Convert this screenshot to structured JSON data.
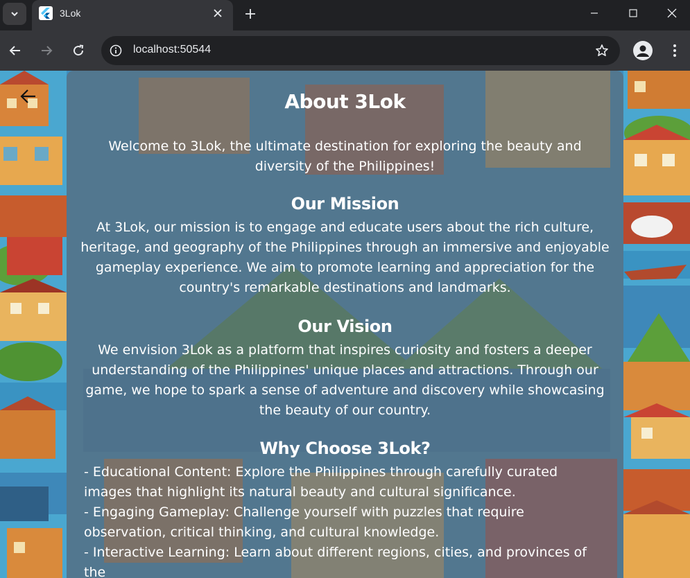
{
  "browser": {
    "tab_title": "3Lok",
    "url": "localhost:50544"
  },
  "page": {
    "title": "About 3Lok",
    "intro": "Welcome to 3Lok, the ultimate destination for exploring the beauty and diversity of the Philippines!",
    "mission": {
      "heading": "Our Mission",
      "text": "At 3Lok, our mission is to engage and educate users about the rich culture, heritage, and geography of the Philippines through an immersive and enjoyable gameplay experience. We aim to promote learning and appreciation for the country's remarkable destinations and landmarks."
    },
    "vision": {
      "heading": "Our Vision",
      "text": "We envision 3Lok as a platform that inspires curiosity and fosters a deeper understanding of the Philippines' unique places and attractions. Through our game, we hope to spark a sense of adventure and discovery while showcasing the beauty of our country."
    },
    "why": {
      "heading": "Why Choose 3Lok?",
      "items": [
        "- Educational Content: Explore the Philippines through carefully curated images that highlight its natural beauty and cultural significance.",
        "- Engaging Gameplay: Challenge yourself with puzzles that require observation, critical thinking, and cultural knowledge.",
        "- Interactive Learning: Learn about different regions, cities, and provinces of the"
      ]
    }
  },
  "icons": {
    "tab_favicon": "flutter-icon",
    "back": "arrow-left-icon"
  },
  "colors": {
    "chrome_dark": "#202124",
    "chrome_toolbar": "#35363a",
    "overlay": "#5a6e7d",
    "text": "#ffffff"
  }
}
